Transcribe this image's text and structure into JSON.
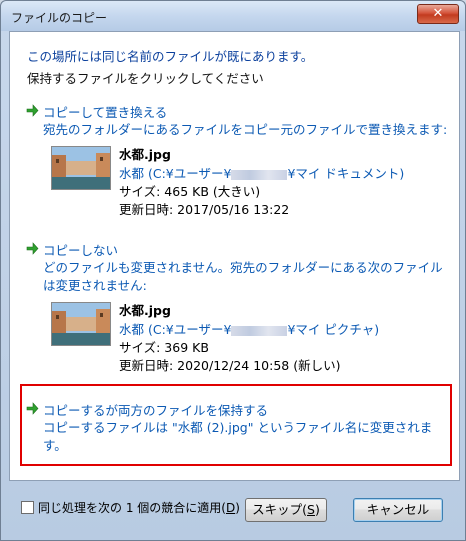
{
  "window": {
    "title": "ファイルのコピー",
    "close_label": "✕"
  },
  "header": {
    "line1": "この場所には同じ名前のファイルが既にあります。",
    "line2": "保持するファイルをクリックしてください"
  },
  "options": [
    {
      "title": "コピーして置き換える",
      "desc": "宛先のフォルダーにあるファイルをコピー元のファイルで置き換えます:",
      "file": {
        "name": "水都.jpg",
        "path_prefix": "水都 (C:¥ユーザー¥",
        "path_suffix": "¥マイ ドキュメント)",
        "size": "サイズ: 465 KB (大きい)",
        "date": "更新日時: 2017/05/16 13:22"
      }
    },
    {
      "title": "コピーしない",
      "desc": "どのファイルも変更されません。宛先のフォルダーにある次のファイルは変更されません:",
      "file": {
        "name": "水都.jpg",
        "path_prefix": "水都 (C:¥ユーザー¥",
        "path_suffix": "¥マイ ピクチャ)",
        "size": "サイズ: 369 KB",
        "date": "更新日時: 2020/12/24 10:58 (新しい)"
      }
    },
    {
      "title": "コピーするが両方のファイルを保持する",
      "desc": "コピーするファイルは \"水都 (2).jpg\" というファイル名に変更されます。"
    }
  ],
  "footer": {
    "apply_all_label": "同じ処理を次の 1 個の競合に適用(",
    "apply_all_key": "D",
    "apply_all_end": ")",
    "skip_label": "スキップ(",
    "skip_key": "S",
    "skip_end": ")",
    "cancel_label": "キャンセル"
  },
  "colors": {
    "link": "#0b59b3",
    "header": "#0a3f9c",
    "highlight": "#e00000"
  },
  "icons": {
    "option_arrow": "green-arrow-icon"
  }
}
